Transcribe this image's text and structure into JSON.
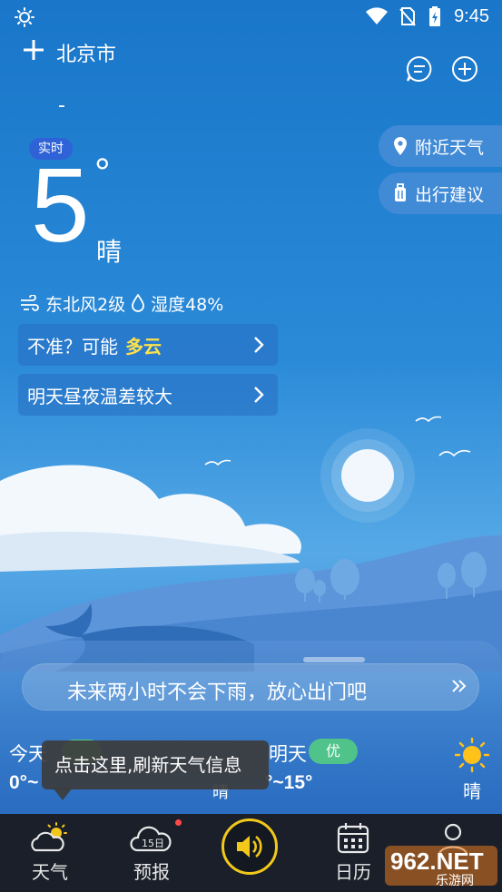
{
  "status_bar": {
    "time": "9:45",
    "icons": [
      "sun-icon",
      "wifi-icon",
      "no-sim-icon",
      "battery-charging-icon"
    ]
  },
  "header": {
    "city": "北京市",
    "dash": "-"
  },
  "current": {
    "badge": "实时",
    "temperature": "5",
    "degree_symbol": "°",
    "condition": "晴",
    "wind": "东北风2级",
    "humidity": "湿度48%"
  },
  "hints": [
    {
      "prefix": "不准？可能",
      "highlight": "多云"
    },
    {
      "prefix": "明天昼夜温差较大",
      "highlight": ""
    }
  ],
  "side_buttons": [
    {
      "label": "附近天气",
      "icon": "location-pin-icon"
    },
    {
      "label": "出行建议",
      "icon": "luggage-icon"
    }
  ],
  "rain_notice": {
    "text": "未来两小时不会下雨，放心出门吧",
    "arrow": "»"
  },
  "today": {
    "label": "今天",
    "temp": "0°~",
    "condition": "晴"
  },
  "tomorrow": {
    "label": "明天",
    "aqi": "优",
    "temp": "°~15°",
    "condition": "晴"
  },
  "tooltip": {
    "text": "点击这里,刷新天气信息"
  },
  "tabs": [
    {
      "label": "天气",
      "icon": "partly-cloudy-icon"
    },
    {
      "label": "预报",
      "icon": "15-day-forecast-icon",
      "icon_text": "15日"
    },
    {
      "label": "",
      "icon": "speaker-icon"
    },
    {
      "label": "日历",
      "icon": "calendar-icon"
    },
    {
      "label": "",
      "icon": "profile-icon"
    }
  ],
  "watermark": {
    "text": "962.NET",
    "sub": "乐游网"
  },
  "colors": {
    "accent": "#f2c81a",
    "highlight": "#ffe14a",
    "aqi_good": "#4fc38a",
    "tab_bg": "#1a1f2a"
  }
}
